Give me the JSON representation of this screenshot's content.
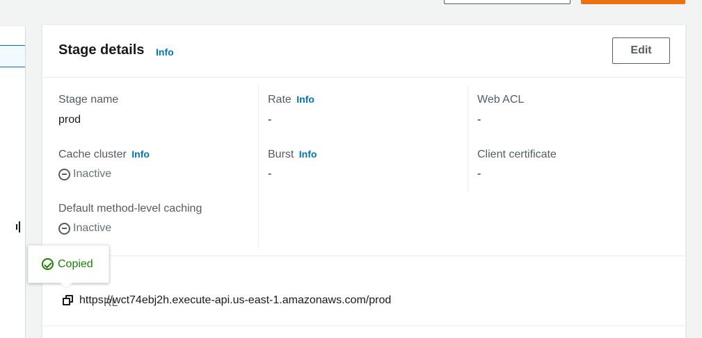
{
  "card": {
    "title": "Stage details",
    "title_info": "Info",
    "edit_label": "Edit"
  },
  "fields": {
    "stage_name": {
      "label": "Stage name",
      "value": "prod"
    },
    "rate": {
      "label": "Rate",
      "info": "Info",
      "value": "-"
    },
    "web_acl": {
      "label": "Web ACL",
      "value": "-"
    },
    "cache_cluster": {
      "label": "Cache cluster",
      "info": "Info",
      "value": "Inactive"
    },
    "burst": {
      "label": "Burst",
      "info": "Info",
      "value": "-"
    },
    "client_certificate": {
      "label": "Client certificate",
      "value": "-"
    },
    "default_caching": {
      "label": "Default method-level caching",
      "value": "Inactive"
    }
  },
  "invoke": {
    "label_partial": "RL",
    "url": "https://wct74ebj2h.execute-api.us-east-1.amazonaws.com/prod"
  },
  "tooltip": {
    "text": "Copied"
  },
  "colors": {
    "primary_button": "#ec7211",
    "link": "#0073bb",
    "success": "#1d8102"
  }
}
